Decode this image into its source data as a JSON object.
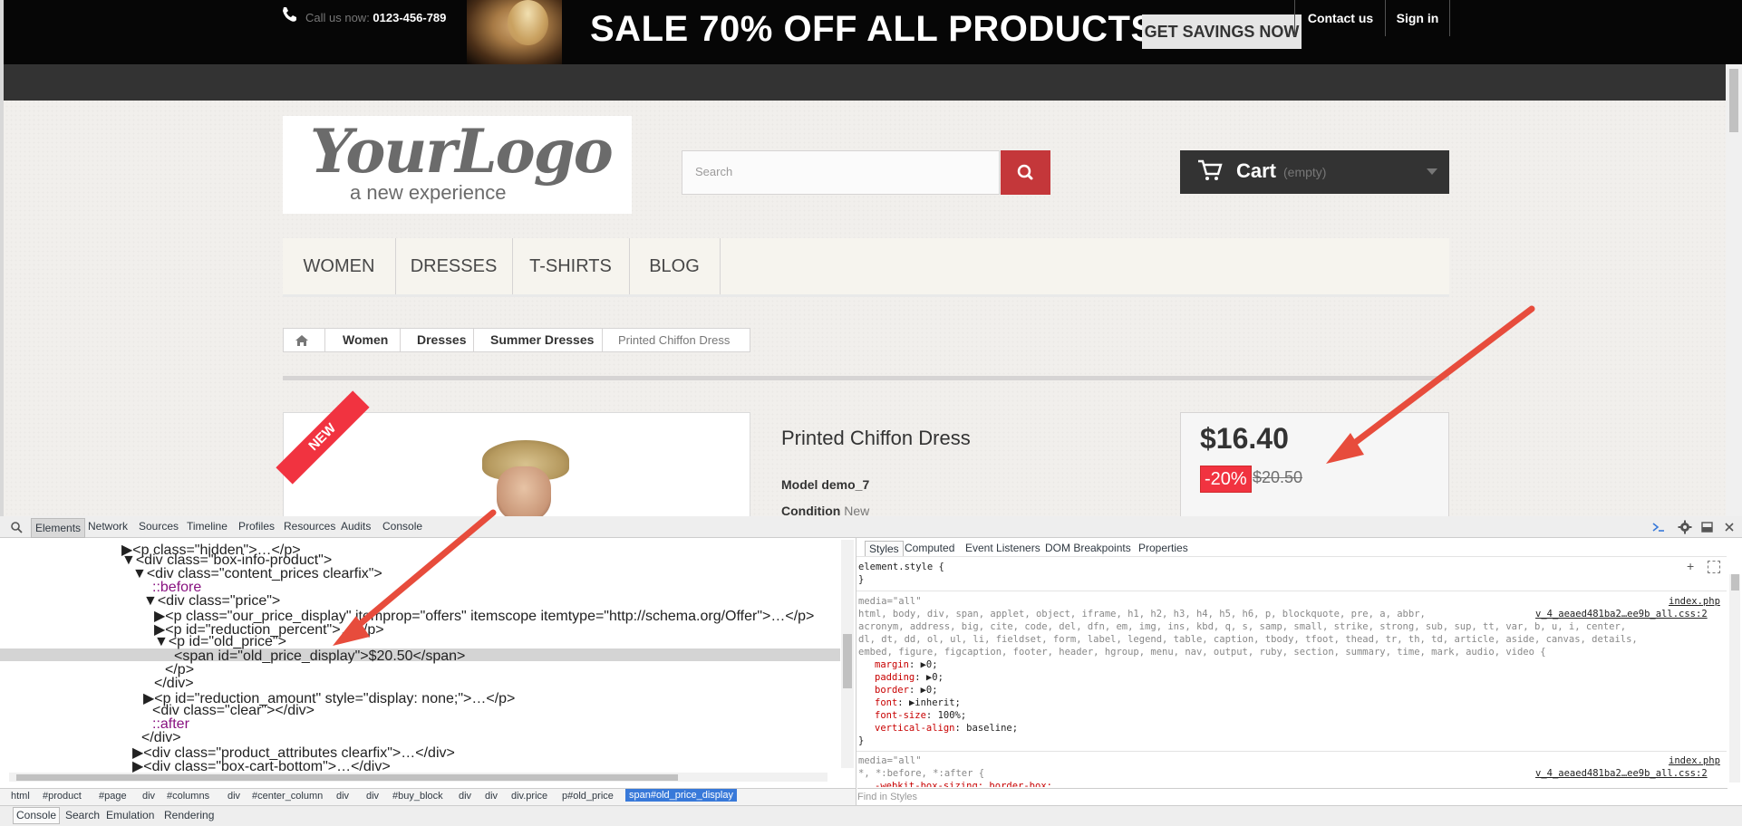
{
  "banner": {
    "headline": "SALE 70% OFF ALL PRODUCTS",
    "cta": "GET SAVINGS NOW"
  },
  "topbar": {
    "call_label": "Call us now: ",
    "phone": "0123-456-789",
    "contact_us": "Contact us",
    "sign_in": "Sign in"
  },
  "logo": {
    "main": "YourLogo",
    "tagline": "a new experience"
  },
  "search": {
    "placeholder": "Search"
  },
  "cart": {
    "label": "Cart",
    "status": "(empty)"
  },
  "nav": {
    "items": [
      "WOMEN",
      "DRESSES",
      "T-SHIRTS",
      "BLOG"
    ]
  },
  "breadcrumb": {
    "items": [
      "Women",
      "Dresses",
      "Summer Dresses"
    ],
    "current": "Printed Chiffon Dress"
  },
  "product": {
    "badge": "NEW",
    "title": "Printed Chiffon Dress",
    "model": "Model demo_7",
    "condition_label": "Condition",
    "condition_value": "New",
    "price": "$16.40",
    "reduction": "-20%",
    "old_price": "$20.50"
  },
  "devtools": {
    "tabs": [
      "Elements",
      "Network",
      "Sources",
      "Timeline",
      "Profiles",
      "Resources",
      "Audits",
      "Console"
    ],
    "dom_lines": [
      "▶<p class=\"hidden\">…</p>",
      "▼<div class=\"box-info-product\">",
      "▼<div class=\"content_prices clearfix\">",
      "::before",
      "▼<div class=\"price\">",
      "▶<p class=\"our_price_display\" itemprop=\"offers\" itemscope itemtype=\"http://schema.org/Offer\">…</p>",
      "▶<p id=\"reduction_percent\">…</p>",
      "▼<p id=\"old_price\">",
      "<span id=\"old_price_display\">$20.50</span>",
      "</p>",
      "</div>",
      "▶<p id=\"reduction_amount\" style=\"display: none;\">…</p>",
      "<div class=\"clear\"></div>",
      "::after",
      "</div>",
      "▶<div class=\"product_attributes clearfix\">…</div>",
      "▶<div class=\"box-cart-bottom\">…</div>"
    ],
    "crumbs": [
      "html",
      "#product",
      "#page",
      "div",
      "#columns",
      "div",
      "#center_column",
      "div",
      "div",
      "#buy_block",
      "div",
      "div",
      "div.price",
      "p#old_price",
      "span#old_price_display"
    ],
    "style_tabs": [
      "Styles",
      "Computed",
      "Event Listeners",
      "DOM Breakpoints",
      "Properties"
    ],
    "element_style": "element.style {",
    "close_brace": "}",
    "media_all": "media=\"all\"",
    "rule1_source": "index.php",
    "rule1_file": "v_4_aeaed481ba2…ee9b_all.css:2",
    "rule1_selector_1": "html, body, div, span, applet, object, iframe, h1, h2, h3, h4, h5, h6, p, blockquote, pre, a, abbr,",
    "rule1_selector_2": "acronym, address, big, cite, code, del, dfn, em, img, ins, kbd, q, s, samp, small, strike, strong, sub, sup, tt, var, b, u, i, center,",
    "rule1_selector_3": "dl, dt, dd, ol, ul, li, fieldset, form, label, legend, table, caption, tbody, tfoot, thead, tr, th, td, article, aside, canvas, details,",
    "rule1_selector_4": "embed, figure, figcaption, footer, header, hgroup, menu, nav, output, ruby, section, summary, time, mark, audio, video {",
    "rule1_props": [
      {
        "name": "margin",
        "value": "▶0;"
      },
      {
        "name": "padding",
        "value": "▶0;"
      },
      {
        "name": "border",
        "value": "▶0;"
      },
      {
        "name": "font",
        "value": "▶inherit;"
      },
      {
        "name": "font-size",
        "value": "100%;"
      },
      {
        "name": "vertical-align",
        "value": "baseline;"
      }
    ],
    "rule2_selector": "*, *:before, *:after {",
    "rule2_partial": "-webkit-box-sizing: border-box;",
    "find_in_styles": "Find in Styles",
    "drawer_tabs": [
      "Console",
      "Search",
      "Emulation",
      "Rendering"
    ]
  },
  "colors": {
    "accent_red": "#c4373a",
    "sale_red": "#f13340",
    "annotation_arrow": "#e74c3c",
    "selection_blue": "#3879d9"
  }
}
